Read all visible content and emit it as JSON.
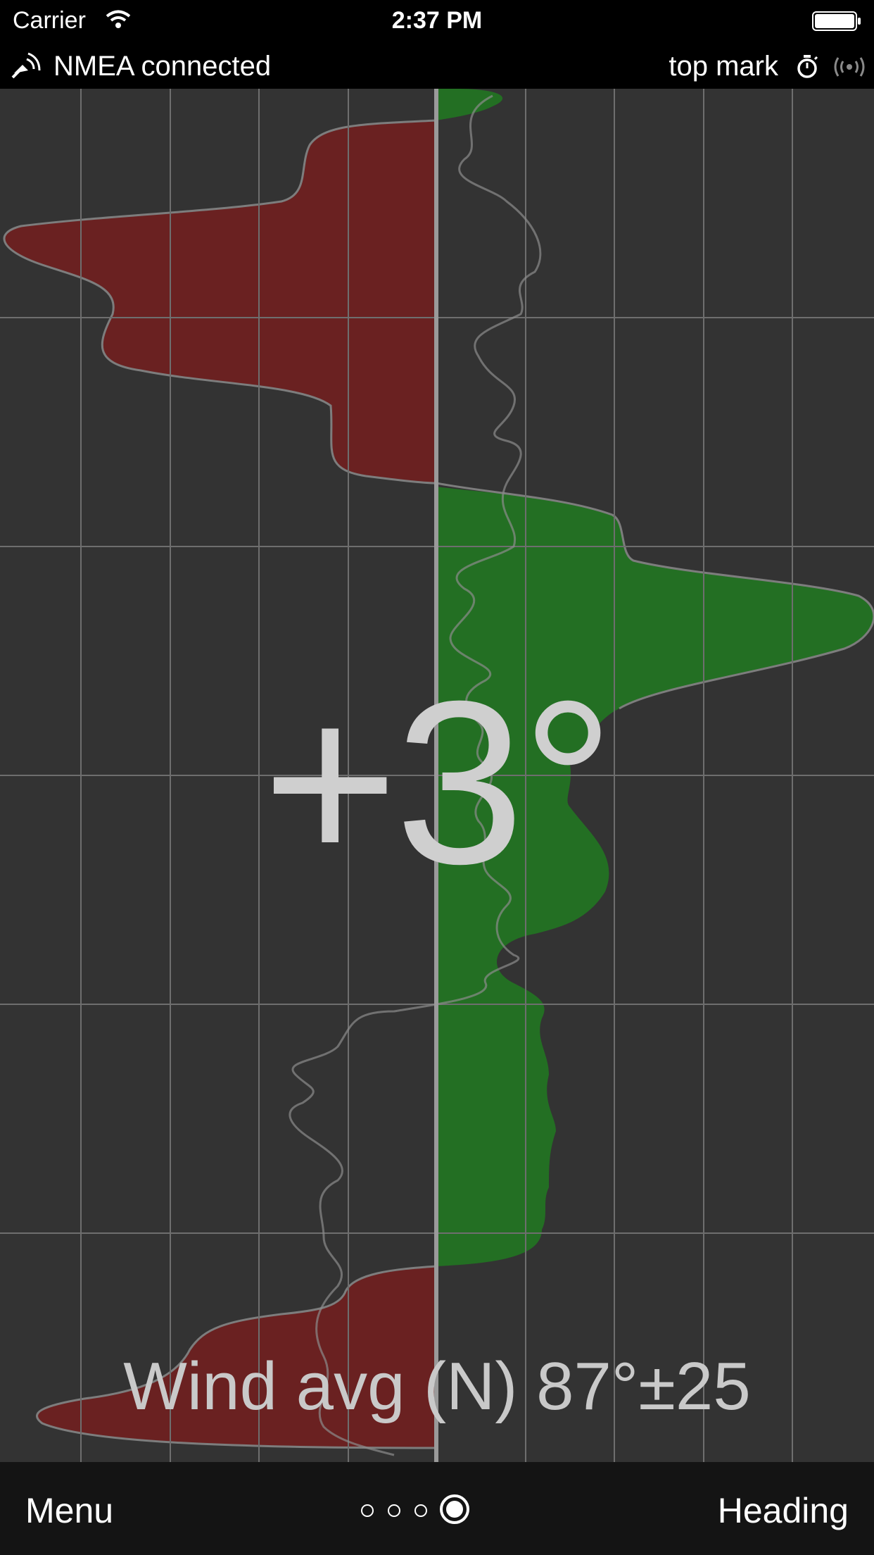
{
  "status_bar": {
    "carrier": "Carrier",
    "time": "2:37 PM"
  },
  "connection_bar": {
    "status_text": "NMEA connected",
    "mark_label": "top mark",
    "icons": [
      "nmea-antenna-icon",
      "stopwatch-icon",
      "broadcast-signal-icon"
    ]
  },
  "display": {
    "heading_offset": "+3°",
    "wind_summary": "Wind avg (N) 87°±25"
  },
  "bottom_bar": {
    "menu_label": "Menu",
    "heading_label": "Heading",
    "page_count": 4,
    "active_page": 3
  },
  "colors": {
    "plot_background": "#333333",
    "port_fill": "#6a2121",
    "starboard_fill": "#236f23",
    "grid": "#6e6e6e",
    "center_line": "#9a9a9a"
  }
}
